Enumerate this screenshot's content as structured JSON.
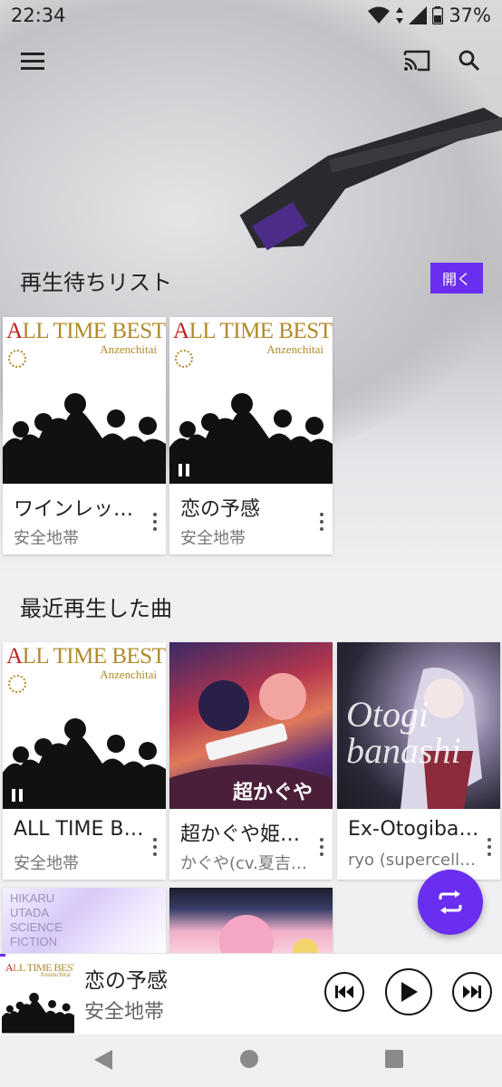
{
  "status_bar": {
    "time": "22:34",
    "battery": "37%"
  },
  "top_bar": {
    "menu_icon": "hamburger-menu-icon",
    "cast_icon": "cast-icon",
    "search_icon": "search-icon"
  },
  "queue_section": {
    "title": "再生待ちリスト",
    "open_button": "開く",
    "items": [
      {
        "title": "ワインレッ…",
        "artist": "安全地帯",
        "art": "all-time-best"
      },
      {
        "title": "恋の予感",
        "artist": "安全地帯",
        "art": "all-time-best",
        "playing": true
      }
    ]
  },
  "recent_section": {
    "title": "最近再生した曲",
    "items": [
      {
        "title": "ALL TIME B…",
        "artist": "安全地帯",
        "art": "all-time-best"
      },
      {
        "title": "超かぐや姫…",
        "artist": "かぐや(cv.夏吉…",
        "art": "anime-cover"
      },
      {
        "title": "Ex-Otogiba…",
        "artist": "ryo (supercell),…",
        "art": "otogibanashi-cover"
      }
    ]
  },
  "album_art_text": {
    "atb_title_first": "A",
    "atb_title_rest": "LL TIME BEST",
    "atb_sub": "Anzenchitai",
    "hikaru_text": "HIKARU UTADA SCIENCE FICTION",
    "otogi_text": "Otogi banashi",
    "kaguya_text": "超かぐや姫!"
  },
  "now_playing": {
    "title": "恋の予感",
    "artist": "安全地帯",
    "progress": 0.01
  },
  "colors": {
    "accent": "#6a2ef0"
  }
}
